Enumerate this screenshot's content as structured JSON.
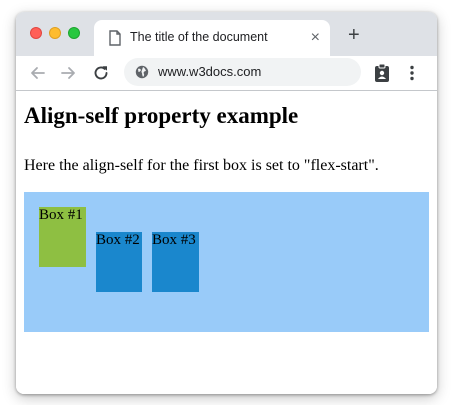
{
  "tab": {
    "title": "The title of the document",
    "close": "×"
  },
  "tabstrip": {
    "new_tab": "+"
  },
  "toolbar": {
    "url": "www.w3docs.com"
  },
  "page": {
    "heading": "Align-self property example",
    "paragraph": "Here the align-self for the first box is set to \"flex-start\".",
    "boxes": [
      "Box #1",
      "Box #2",
      "Box #3"
    ]
  },
  "colors": {
    "box_1": "#8ebf42",
    "box_2_3": "#1a87cd",
    "container": "#99cbf9"
  },
  "icons": [
    "document-icon",
    "back-icon",
    "forward-icon",
    "reload-icon",
    "globe-icon",
    "extension-icon",
    "menu-icon"
  ]
}
